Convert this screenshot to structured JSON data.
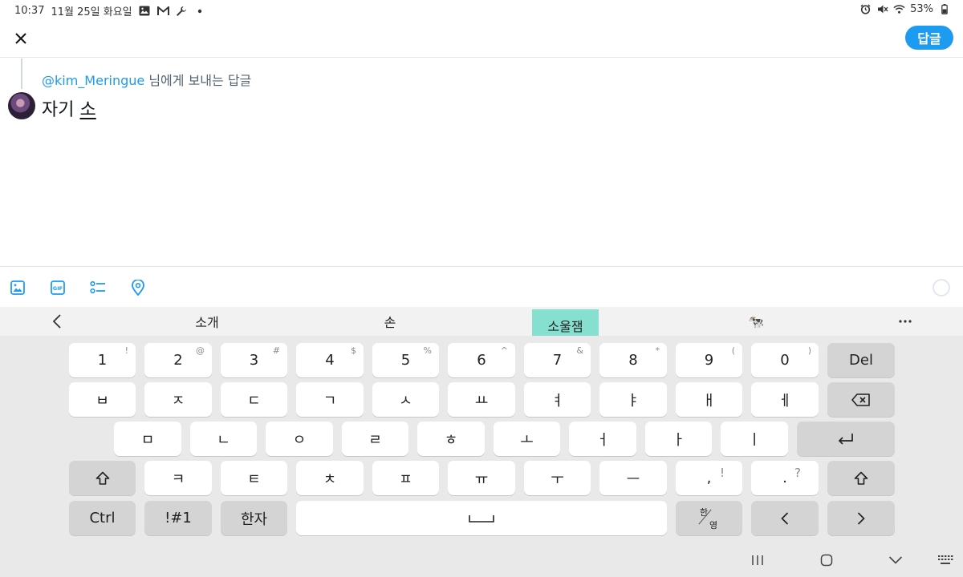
{
  "status": {
    "time": "10:37",
    "date": "11월 25일 화요일",
    "battery": "53%",
    "left_icons": [
      "gallery-icon",
      "gmail-icon",
      "wrench-icon",
      "dot-icon"
    ],
    "right_icons": [
      "alarm-icon",
      "mute-icon",
      "wifi-icon",
      "battery-icon"
    ]
  },
  "header": {
    "reply_label": "답글",
    "close_icon": "close-icon"
  },
  "compose": {
    "handle": "@kim_Meringue",
    "reply_suffix": " 님에게 보내는 답글",
    "text_before": "자기 ",
    "text_composing": "소"
  },
  "toolbar": {
    "icons": [
      "image-icon",
      "gif-icon",
      "poll-icon",
      "location-icon",
      "character-counter-icon"
    ]
  },
  "suggestions": {
    "items": [
      "소개",
      "손",
      "소울잼",
      "🐄"
    ],
    "highlighted_index": 2,
    "accent": "#86e0cf"
  },
  "keyboard": {
    "row1": [
      {
        "label": "1",
        "sup": "!"
      },
      {
        "label": "2",
        "sup": "@"
      },
      {
        "label": "3",
        "sup": "#"
      },
      {
        "label": "4",
        "sup": "$"
      },
      {
        "label": "5",
        "sup": "%"
      },
      {
        "label": "6",
        "sup": "^"
      },
      {
        "label": "7",
        "sup": "&"
      },
      {
        "label": "8",
        "sup": "*"
      },
      {
        "label": "9",
        "sup": "("
      },
      {
        "label": "0",
        "sup": ")"
      },
      {
        "label": "Del",
        "sup": ""
      }
    ],
    "row2": [
      "ㅂ",
      "ㅈ",
      "ㄷ",
      "ㄱ",
      "ㅅ",
      "ㅛ",
      "ㅕ",
      "ㅑ",
      "ㅐ",
      "ㅔ"
    ],
    "row3": [
      "ㅁ",
      "ㄴ",
      "ㅇ",
      "ㄹ",
      "ㅎ",
      "ㅗ",
      "ㅓ",
      "ㅏ",
      "ㅣ"
    ],
    "row4": [
      "ㅋ",
      "ㅌ",
      "ㅊ",
      "ㅍ",
      "ㅠ",
      "ㅜ",
      "ㅡ"
    ],
    "row4_punct": [
      {
        "label": ",",
        "sup": "!"
      },
      {
        "label": ".",
        "sup": "?"
      }
    ],
    "row5": {
      "ctrl": "Ctrl",
      "symbols": "!#1",
      "hanja": "한자",
      "lang_top": "한",
      "lang_bottom": "영"
    }
  },
  "colors": {
    "brand": "#1d9bf0",
    "keyboard_bg": "#e9e9e9",
    "key_dark": "#d4d4d4"
  }
}
